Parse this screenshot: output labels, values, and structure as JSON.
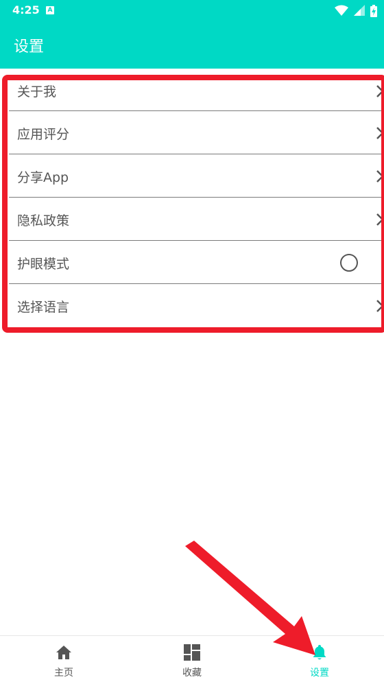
{
  "status_bar": {
    "time": "4:25",
    "badge": "A"
  },
  "app_bar": {
    "title": "设置"
  },
  "settings": {
    "items": [
      {
        "label": "关于我",
        "trailing": "chevron-right-icon"
      },
      {
        "label": "应用评分",
        "trailing": "chevron-right-icon"
      },
      {
        "label": "分享App",
        "trailing": "chevron-right-icon"
      },
      {
        "label": "隐私政策",
        "trailing": "chevron-right-icon"
      },
      {
        "label": "护眼模式",
        "trailing": "radio-circle",
        "checked": false
      },
      {
        "label": "选择语言",
        "trailing": "chevron-right-icon"
      }
    ]
  },
  "bottom_nav": {
    "items": [
      {
        "label": "主页",
        "icon": "home-icon",
        "active": false
      },
      {
        "label": "收藏",
        "icon": "dashboard-icon",
        "active": false
      },
      {
        "label": "设置",
        "icon": "bell-icon",
        "active": true
      }
    ]
  },
  "colors": {
    "accent": "#00d9c5",
    "annotation": "#ee1c2a",
    "text": "#555555"
  }
}
